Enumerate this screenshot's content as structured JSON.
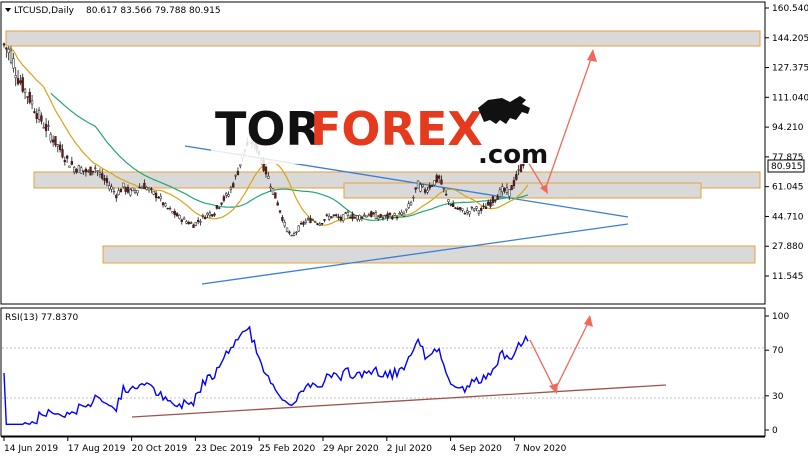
{
  "chart_data": [
    {
      "type": "candlestick",
      "header": "LTCUSD,Daily  80.617 83.566 79.788 80.915",
      "symbol_label": "LTCUSD,Daily",
      "ohlc_label": "80.617 83.566 79.788 80.915",
      "ohlc": {
        "open": 80.617,
        "high": 83.566,
        "low": 79.788,
        "close": 80.915
      },
      "last_price": "80.915",
      "y_ticks": [
        "160.540",
        "144.205",
        "127.375",
        "111.040",
        "94.210",
        "77.875",
        "61.045",
        "44.710",
        "27.880",
        "11.545"
      ],
      "ylim": [
        11.545,
        160.54
      ],
      "x_ticks": [
        "14 Jun 2019",
        "17 Aug 2019",
        "20 Oct 2019",
        "23 Dec 2019",
        "25 Feb 2020",
        "29 Apr 2020",
        "2 Jul 2020",
        "4 Sep 2020",
        "7 Nov 2020"
      ],
      "approx_closes": [
        [
          0,
          140
        ],
        [
          3,
          135
        ],
        [
          6,
          122
        ],
        [
          9,
          115
        ],
        [
          12,
          108
        ],
        [
          15,
          100
        ],
        [
          18,
          94
        ],
        [
          21,
          88
        ],
        [
          24,
          82
        ],
        [
          27,
          76
        ],
        [
          30,
          72
        ],
        [
          33,
          71
        ],
        [
          36,
          69
        ],
        [
          39,
          72
        ],
        [
          42,
          66
        ],
        [
          45,
          62
        ],
        [
          48,
          57
        ],
        [
          51,
          61
        ],
        [
          54,
          58
        ],
        [
          57,
          60
        ],
        [
          60,
          62
        ],
        [
          63,
          58
        ],
        [
          66,
          56
        ],
        [
          69,
          50
        ],
        [
          72,
          47
        ],
        [
          75,
          44
        ],
        [
          78,
          42
        ],
        [
          81,
          40
        ],
        [
          84,
          43
        ],
        [
          87,
          46
        ],
        [
          90,
          47
        ],
        [
          93,
          53
        ],
        [
          96,
          57
        ],
        [
          99,
          66
        ],
        [
          102,
          78
        ],
        [
          105,
          88
        ],
        [
          108,
          84
        ],
        [
          111,
          73
        ],
        [
          114,
          63
        ],
        [
          117,
          52
        ],
        [
          120,
          40
        ],
        [
          123,
          33
        ],
        [
          126,
          38
        ],
        [
          129,
          42
        ],
        [
          132,
          43
        ],
        [
          135,
          41
        ],
        [
          138,
          44
        ],
        [
          141,
          45
        ],
        [
          144,
          43
        ],
        [
          147,
          46
        ],
        [
          150,
          44
        ],
        [
          153,
          45
        ],
        [
          156,
          46
        ],
        [
          159,
          45
        ],
        [
          162,
          44
        ],
        [
          165,
          45
        ],
        [
          168,
          45
        ],
        [
          171,
          46
        ],
        [
          174,
          52
        ],
        [
          177,
          62
        ],
        [
          180,
          59
        ],
        [
          183,
          63
        ],
        [
          186,
          66
        ],
        [
          189,
          56
        ],
        [
          192,
          50
        ],
        [
          195,
          48
        ],
        [
          198,
          47
        ],
        [
          201,
          49
        ],
        [
          204,
          48
        ],
        [
          207,
          51
        ],
        [
          210,
          55
        ],
        [
          213,
          59
        ],
        [
          216,
          58
        ],
        [
          219,
          66
        ],
        [
          222,
          75
        ],
        [
          224,
          81
        ]
      ],
      "sma_slow": "teal",
      "sma_fast": "orange"
    },
    {
      "type": "line",
      "label": "RSI(13) 77.8370",
      "name": "RSI(13)",
      "value": "77.8370",
      "y_ticks": [
        "100",
        "70",
        "30",
        "0"
      ],
      "ylim": [
        0,
        100
      ]
    }
  ],
  "logo": {
    "part1": "TOR",
    "part2": "FOREX",
    "part3": ".com"
  },
  "colors": {
    "zone_fill": "#d7d7d7",
    "zone_border": "#e8a23a",
    "trendline": "#3b7ed6",
    "support_rsi": "#a0524a",
    "projection": "#f2685a",
    "sma_teal": "#22a67a",
    "sma_orange": "#d9a41c",
    "rsi_line": "#0000ff",
    "candle": "#8b0000",
    "price_box": "#ffffff"
  }
}
